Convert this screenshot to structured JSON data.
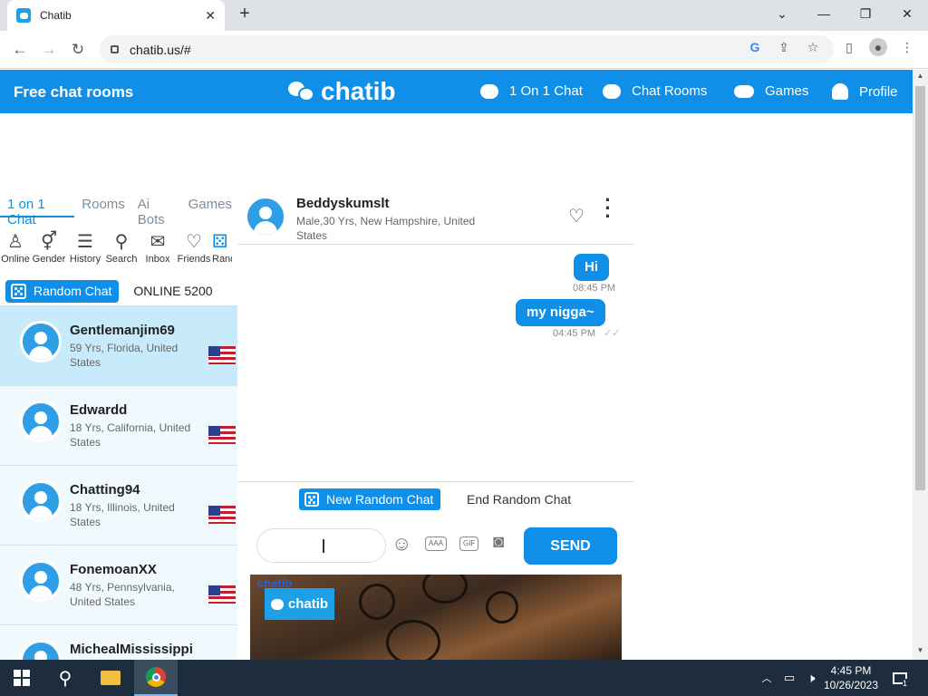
{
  "browser": {
    "tab_title": "Chatib",
    "url": "chatib.us/#"
  },
  "header": {
    "left_title": "Free chat rooms",
    "logo_text": "chatib",
    "nav": [
      "1 On 1 Chat",
      "Chat Rooms",
      "Games",
      "Profile"
    ]
  },
  "left_panel": {
    "tabs": [
      "1 on 1 Chat",
      "Rooms",
      "Ai Bots",
      "Games"
    ],
    "icons": [
      {
        "label": "Online",
        "icon": "person-online-icon"
      },
      {
        "label": "Gender",
        "icon": "gender-icon"
      },
      {
        "label": "History",
        "icon": "list-icon"
      },
      {
        "label": "Search",
        "icon": "search-icon"
      },
      {
        "label": "Inbox",
        "icon": "envelope-icon"
      },
      {
        "label": "Friends",
        "icon": "heart-icon"
      },
      {
        "label": "Rand",
        "icon": "dice-icon"
      }
    ],
    "random_chat_label": "Random Chat",
    "online_count": "ONLINE 5200"
  },
  "users": [
    {
      "name": "Gentlemanjim69",
      "info": "59 Yrs, Florida, United States",
      "selected": true
    },
    {
      "name": "Edwardd",
      "info": "18 Yrs, California, United States",
      "selected": false
    },
    {
      "name": "Chatting94",
      "info": "18 Yrs, Illinois, United States",
      "selected": false
    },
    {
      "name": "FonemoanXX",
      "info": "48 Yrs, Pennsylvania, United States",
      "selected": false
    },
    {
      "name": "MichealMississippi",
      "info": "",
      "selected": false
    }
  ],
  "chat": {
    "partner_name": "Beddyskumslt",
    "partner_info": "Male,30 Yrs, New Hampshire, United States",
    "messages": [
      {
        "text": "Hi",
        "time": "08:45 PM"
      },
      {
        "text": "my nigga~",
        "time": "04:45 PM"
      }
    ],
    "new_random_chat_label": "New Random Chat",
    "end_random_chat_label": "End Random Chat",
    "send_label": "SEND",
    "text_style_label": "AAA",
    "gif_label": "GIF"
  },
  "video": {
    "watermark_small": "chatib",
    "watermark_logo": "chatib"
  },
  "taskbar": {
    "time": "4:45 PM",
    "date": "10/26/2023",
    "notification_count": "1"
  },
  "colors": {
    "accent": "#0f8fe7",
    "selected_row": "#c7ebfa",
    "row_bg": "#f0f9fd",
    "taskbar": "#1e2d3d"
  }
}
